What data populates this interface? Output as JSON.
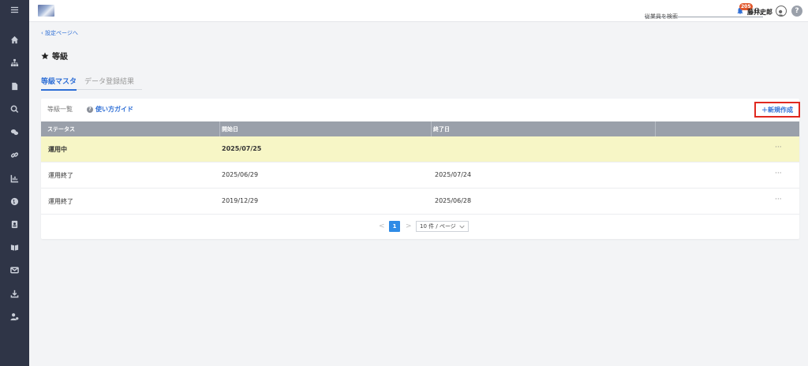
{
  "topbar": {
    "search_placeholder": "従業員を検索",
    "notification_count": "205",
    "user_name": "藤井史郎",
    "help_glyph": "?"
  },
  "sidebar": {
    "items": [
      "menu-icon",
      "home-icon",
      "org-chart-icon",
      "document-icon",
      "search-icon",
      "chat-icon",
      "link-icon",
      "chart-icon",
      "globe-icon",
      "contacts-icon",
      "book-icon",
      "mail-icon",
      "download-icon",
      "user-settings-icon"
    ]
  },
  "breadcrumb": {
    "back_label": "設定ページへ"
  },
  "page": {
    "title": "等級"
  },
  "tabs": [
    {
      "label": "等級マスタ",
      "active": true
    },
    {
      "label": "データ登録結果",
      "active": false
    }
  ],
  "card": {
    "list_label": "等級一覧",
    "guide_label": "使い方ガイド",
    "new_button_label": "＋新規作成"
  },
  "table": {
    "headers": [
      "ステータス",
      "開始日",
      "終了日"
    ],
    "rows": [
      {
        "status": "運用中",
        "start": "2025/07/25",
        "end": "",
        "highlight": true
      },
      {
        "status": "運用終了",
        "start": "2025/06/29",
        "end": "2025/07/24",
        "highlight": false
      },
      {
        "status": "運用終了",
        "start": "2019/12/29",
        "end": "2025/06/28",
        "highlight": false
      }
    ],
    "row_action_glyph": "···"
  },
  "pagination": {
    "prev": "<",
    "current_page": "1",
    "next": ">",
    "page_size_label": "10 件 / ページ"
  },
  "colors": {
    "sidebar_bg": "#2f3547",
    "accent_blue": "#2f6fd6",
    "highlight_row": "#f7f6c6",
    "table_header": "#9aa0aa",
    "badge_red": "#e2582d",
    "new_button_border": "#e0281f"
  }
}
